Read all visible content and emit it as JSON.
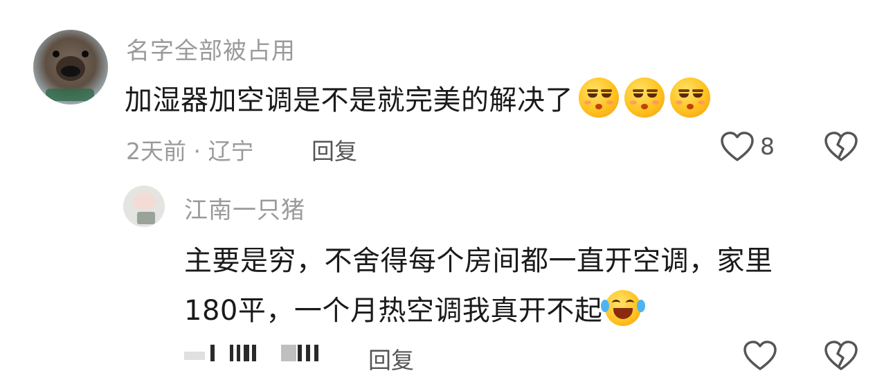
{
  "comments": [
    {
      "username": "名字全部被占用",
      "content": "加湿器加空调是不是就完美的解决了",
      "emoji_count": 3,
      "meta": "2天前 · 辽宁",
      "reply_label": "回复",
      "like_count": "8"
    }
  ],
  "reply": {
    "username": "江南一只猪",
    "content_line1": "主要是穷，不舍得每个房间都一直开空调，家里",
    "content_line2": "180平，一个月热空调我真开不起",
    "reply_label": "回复"
  },
  "icons": {
    "like": "heart-outline-icon",
    "dislike": "broken-heart-icon",
    "emoji_main": "unamused-face-emoji",
    "emoji_reply": "laughing-crying-emoji"
  }
}
